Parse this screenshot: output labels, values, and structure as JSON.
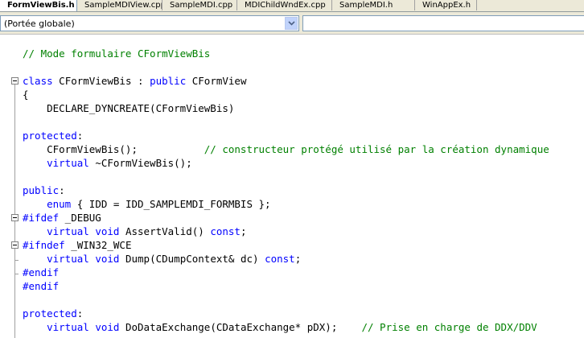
{
  "tabs": [
    {
      "label": "FormViewBis.h",
      "active": true
    },
    {
      "label": "SampleMDIView.cpp",
      "active": false
    },
    {
      "label": "SampleMDI.cpp",
      "active": false
    },
    {
      "label": "MDIChildWndEx.cpp",
      "active": false
    },
    {
      "label": "SampleMDI.h",
      "active": false
    },
    {
      "label": "WinAppEx.h",
      "active": false
    }
  ],
  "scope_bar": {
    "scope_value": "(Portée globale)",
    "member_value": ""
  },
  "code": {
    "lines": [
      {
        "row": 1,
        "segments": [
          {
            "t": "// Mode formulaire CFormViewBis",
            "c": "cm"
          }
        ]
      },
      {
        "row": 3,
        "segments": [
          {
            "t": "class",
            "c": "kw"
          },
          {
            "t": " CFormViewBis : ",
            "c": ""
          },
          {
            "t": "public",
            "c": "kw"
          },
          {
            "t": " CFormView",
            "c": ""
          }
        ]
      },
      {
        "row": 4,
        "segments": [
          {
            "t": "{",
            "c": ""
          }
        ]
      },
      {
        "row": 5,
        "segments": [
          {
            "t": "    DECLARE_DYNCREATE(CFormViewBis)",
            "c": ""
          }
        ]
      },
      {
        "row": 7,
        "segments": [
          {
            "t": "protected",
            "c": "kw"
          },
          {
            "t": ":",
            "c": ""
          }
        ]
      },
      {
        "row": 8,
        "segments": [
          {
            "t": "    CFormViewBis();           ",
            "c": ""
          },
          {
            "t": "// constructeur protégé utilisé par la création dynamique",
            "c": "cm"
          }
        ]
      },
      {
        "row": 9,
        "segments": [
          {
            "t": "    ",
            "c": ""
          },
          {
            "t": "virtual",
            "c": "kw"
          },
          {
            "t": " ~CFormViewBis();",
            "c": ""
          }
        ]
      },
      {
        "row": 11,
        "segments": [
          {
            "t": "public",
            "c": "kw"
          },
          {
            "t": ":",
            "c": ""
          }
        ]
      },
      {
        "row": 12,
        "segments": [
          {
            "t": "    ",
            "c": ""
          },
          {
            "t": "enum",
            "c": "kw"
          },
          {
            "t": " { IDD = IDD_SAMPLEMDI_FORMBIS };",
            "c": ""
          }
        ]
      },
      {
        "row": 13,
        "segments": [
          {
            "t": "#ifdef",
            "c": "kw"
          },
          {
            "t": " _DEBUG",
            "c": ""
          }
        ]
      },
      {
        "row": 14,
        "segments": [
          {
            "t": "    ",
            "c": ""
          },
          {
            "t": "virtual",
            "c": "kw"
          },
          {
            "t": " ",
            "c": ""
          },
          {
            "t": "void",
            "c": "kw"
          },
          {
            "t": " AssertValid() ",
            "c": ""
          },
          {
            "t": "const",
            "c": "kw"
          },
          {
            "t": ";",
            "c": ""
          }
        ]
      },
      {
        "row": 15,
        "segments": [
          {
            "t": "#ifndef",
            "c": "kw"
          },
          {
            "t": " _WIN32_WCE",
            "c": ""
          }
        ]
      },
      {
        "row": 16,
        "segments": [
          {
            "t": "    ",
            "c": ""
          },
          {
            "t": "virtual",
            "c": "kw"
          },
          {
            "t": " ",
            "c": ""
          },
          {
            "t": "void",
            "c": "kw"
          },
          {
            "t": " Dump(CDumpContext& dc) ",
            "c": ""
          },
          {
            "t": "const",
            "c": "kw"
          },
          {
            "t": ";",
            "c": ""
          }
        ]
      },
      {
        "row": 17,
        "segments": [
          {
            "t": "#endif",
            "c": "kw"
          }
        ]
      },
      {
        "row": 18,
        "segments": [
          {
            "t": "#endif",
            "c": "kw"
          }
        ]
      },
      {
        "row": 20,
        "segments": [
          {
            "t": "protected",
            "c": "kw"
          },
          {
            "t": ":",
            "c": ""
          }
        ]
      },
      {
        "row": 21,
        "segments": [
          {
            "t": "    ",
            "c": ""
          },
          {
            "t": "virtual",
            "c": "kw"
          },
          {
            "t": " ",
            "c": ""
          },
          {
            "t": "void",
            "c": "kw"
          },
          {
            "t": " DoDataExchange(CDataExchange* pDX);    ",
            "c": ""
          },
          {
            "t": "// Prise en charge de DDX/DDV",
            "c": "cm"
          }
        ]
      }
    ]
  },
  "colors": {
    "keyword": "#0000ff",
    "comment": "#008000",
    "text": "#000000",
    "chrome": "#ece9d8"
  }
}
